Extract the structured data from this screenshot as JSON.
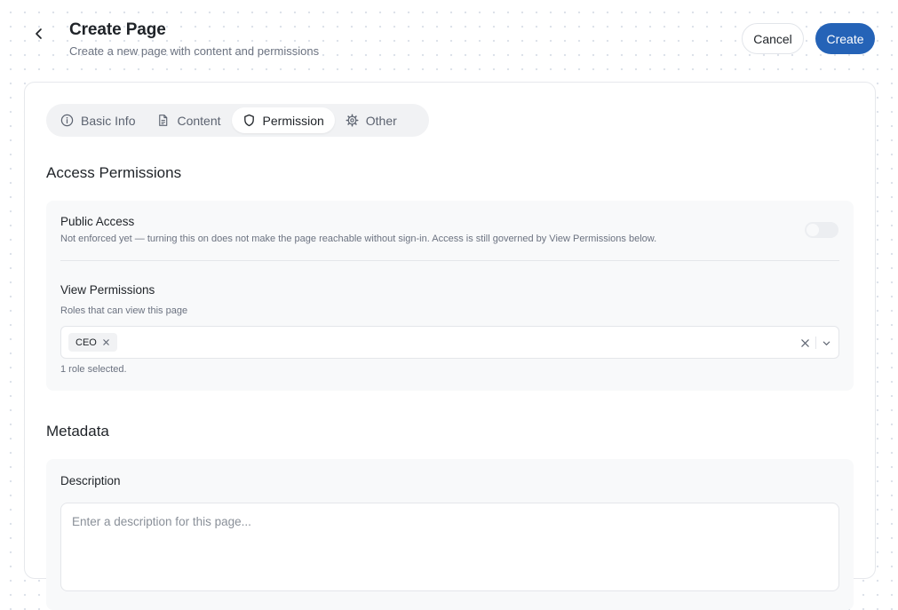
{
  "header": {
    "title": "Create Page",
    "subtitle": "Create a new page with content and permissions",
    "cancel_label": "Cancel",
    "create_label": "Create"
  },
  "tabs": [
    {
      "label": "Basic Info",
      "icon": "info-icon"
    },
    {
      "label": "Content",
      "icon": "document-icon"
    },
    {
      "label": "Permission",
      "icon": "shield-icon",
      "active": true
    },
    {
      "label": "Other",
      "icon": "gear-icon"
    }
  ],
  "access": {
    "title": "Access Permissions",
    "public_access": {
      "label": "Public Access",
      "help": "Not enforced yet — turning this on does not make the page reachable without sign-in. Access is still governed by View Permissions below.",
      "enabled": false
    },
    "view_permissions": {
      "label": "View Permissions",
      "help": "Roles that can view this page",
      "selected": [
        "CEO"
      ],
      "count_text": "1 role selected."
    }
  },
  "metadata": {
    "title": "Metadata",
    "description_label": "Description",
    "description_placeholder": "Enter a description for this page...",
    "description_value": ""
  },
  "colors": {
    "primary": "#2563b7",
    "panel_bg": "#f8f9fa",
    "border": "#e4e6ea"
  }
}
